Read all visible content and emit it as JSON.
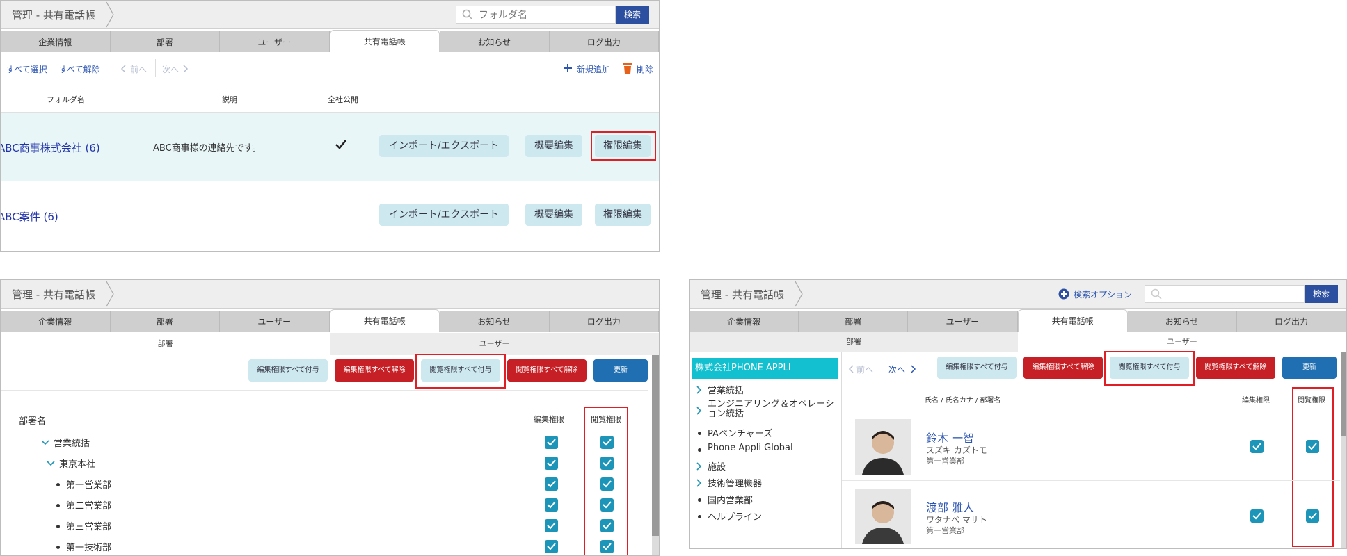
{
  "common": {
    "breadcrumb": "管理 - 共有電話帳",
    "tabs": [
      "企業情報",
      "部署",
      "ユーザー",
      "共有電話帳",
      "お知らせ",
      "ログ出力"
    ],
    "search_button": "検索",
    "update_button": "更新"
  },
  "panel1": {
    "search_placeholder": "フォルダ名",
    "toolbar": {
      "select_all": "すべて選択",
      "deselect_all": "すべて解除",
      "prev": "前へ",
      "next": "次へ",
      "add_new": "新規追加",
      "delete": "削除"
    },
    "columns": [
      "フォルダ名",
      "説明",
      "全社公開"
    ],
    "rows": [
      {
        "name": "ABC商事株式会社 (6)",
        "description": "ABC商事様の連絡先です。",
        "public": true
      },
      {
        "name": "ABC案件 (6)",
        "description": "",
        "public": false
      }
    ],
    "row_buttons": [
      "インポート/エクスポート",
      "概要編集",
      "権限編集"
    ]
  },
  "panel2": {
    "subtabs": [
      "部署",
      "ユーザー"
    ],
    "actions": [
      "編集権限すべて付与",
      "編集権限すべて解除",
      "閲覧権限すべて付与",
      "閲覧権限すべて解除"
    ],
    "column_dept": "部署名",
    "column_edit": "編集権限",
    "column_view": "閲覧権限",
    "tree": [
      "営業統括",
      "東京本社",
      "第一営業部",
      "第二営業部",
      "第三営業部",
      "第一技術部"
    ]
  },
  "panel3": {
    "search_options": "検索オプション",
    "subtabs": [
      "部署",
      "ユーザー"
    ],
    "company": "株式会社PHONE APPLI",
    "tree": [
      "営業統括",
      "エンジニアリング＆オペレーション統括",
      "PAベンチャーズ",
      "Phone Appli Global",
      "施設",
      "技術管理機器",
      "国内営業部",
      "ヘルプライン"
    ],
    "prev": "前へ",
    "next": "次へ",
    "actions": [
      "編集権限すべて付与",
      "編集権限すべて解除",
      "閲覧権限すべて付与",
      "閲覧権限すべて解除"
    ],
    "column_user": "氏名 / 氏名カナ / 部署名",
    "column_edit": "編集権限",
    "column_view": "閲覧権限",
    "users": [
      {
        "name": "鈴木 一智",
        "kana": "スズキ カズトモ",
        "dept": "第一営業部"
      },
      {
        "name": "渡部 雅人",
        "kana": "ワタナベ マサト",
        "dept": "第一営業部"
      }
    ]
  }
}
